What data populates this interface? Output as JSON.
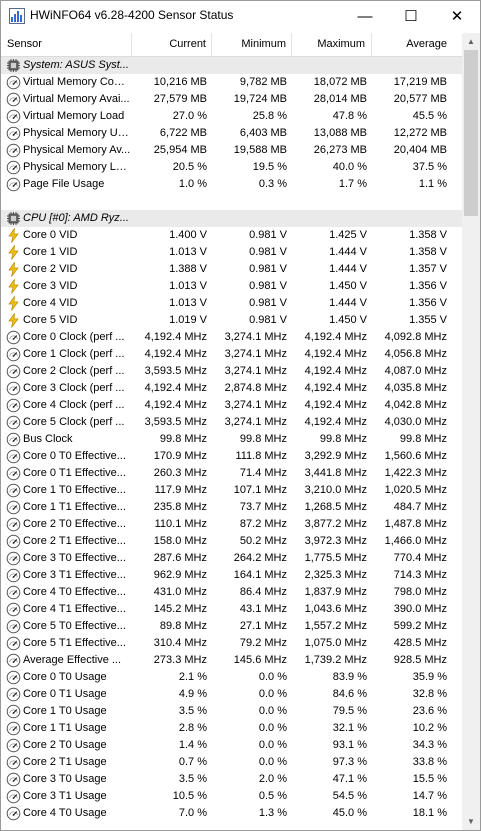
{
  "window": {
    "title": "HWiNFO64 v6.28-4200 Sensor Status",
    "minimize_glyph": "—",
    "maximize_glyph": "☐",
    "close_glyph": "✕"
  },
  "columns": {
    "sensor": "Sensor",
    "current": "Current",
    "minimum": "Minimum",
    "maximum": "Maximum",
    "average": "Average"
  },
  "rows": [
    {
      "kind": "group",
      "icon": "chip-icon",
      "name": "System: ASUS Syst..."
    },
    {
      "kind": "data",
      "icon": "gauge-icon",
      "name": "Virtual Memory Com...",
      "cur": "10,216 MB",
      "min": "9,782 MB",
      "max": "18,072 MB",
      "avg": "17,219 MB"
    },
    {
      "kind": "data",
      "icon": "gauge-icon",
      "name": "Virtual Memory Avai...",
      "cur": "27,579 MB",
      "min": "19,724 MB",
      "max": "28,014 MB",
      "avg": "20,577 MB"
    },
    {
      "kind": "data",
      "icon": "gauge-icon",
      "name": "Virtual Memory Load",
      "cur": "27.0 %",
      "min": "25.8 %",
      "max": "47.8 %",
      "avg": "45.5 %"
    },
    {
      "kind": "data",
      "icon": "gauge-icon",
      "name": "Physical Memory Used",
      "cur": "6,722 MB",
      "min": "6,403 MB",
      "max": "13,088 MB",
      "avg": "12,272 MB"
    },
    {
      "kind": "data",
      "icon": "gauge-icon",
      "name": "Physical Memory Av...",
      "cur": "25,954 MB",
      "min": "19,588 MB",
      "max": "26,273 MB",
      "avg": "20,404 MB"
    },
    {
      "kind": "data",
      "icon": "gauge-icon",
      "name": "Physical Memory Load",
      "cur": "20.5 %",
      "min": "19.5 %",
      "max": "40.0 %",
      "avg": "37.5 %"
    },
    {
      "kind": "data",
      "icon": "gauge-icon",
      "name": "Page File Usage",
      "cur": "1.0 %",
      "min": "0.3 %",
      "max": "1.7 %",
      "avg": "1.1 %"
    },
    {
      "kind": "blank"
    },
    {
      "kind": "group",
      "icon": "cpu-icon",
      "name": "CPU [#0]: AMD Ryz..."
    },
    {
      "kind": "data",
      "icon": "lightning-icon",
      "name": "Core 0 VID",
      "cur": "1.400 V",
      "min": "0.981 V",
      "max": "1.425 V",
      "avg": "1.358 V"
    },
    {
      "kind": "data",
      "icon": "lightning-icon",
      "name": "Core 1 VID",
      "cur": "1.013 V",
      "min": "0.981 V",
      "max": "1.444 V",
      "avg": "1.358 V"
    },
    {
      "kind": "data",
      "icon": "lightning-icon",
      "name": "Core 2 VID",
      "cur": "1.388 V",
      "min": "0.981 V",
      "max": "1.444 V",
      "avg": "1.357 V"
    },
    {
      "kind": "data",
      "icon": "lightning-icon",
      "name": "Core 3 VID",
      "cur": "1.013 V",
      "min": "0.981 V",
      "max": "1.450 V",
      "avg": "1.356 V"
    },
    {
      "kind": "data",
      "icon": "lightning-icon",
      "name": "Core 4 VID",
      "cur": "1.013 V",
      "min": "0.981 V",
      "max": "1.444 V",
      "avg": "1.356 V"
    },
    {
      "kind": "data",
      "icon": "lightning-icon",
      "name": "Core 5 VID",
      "cur": "1.019 V",
      "min": "0.981 V",
      "max": "1.450 V",
      "avg": "1.355 V"
    },
    {
      "kind": "data",
      "icon": "gauge-icon",
      "name": "Core 0 Clock (perf ...",
      "cur": "4,192.4 MHz",
      "min": "3,274.1 MHz",
      "max": "4,192.4 MHz",
      "avg": "4,092.8 MHz"
    },
    {
      "kind": "data",
      "icon": "gauge-icon",
      "name": "Core 1 Clock (perf ...",
      "cur": "4,192.4 MHz",
      "min": "3,274.1 MHz",
      "max": "4,192.4 MHz",
      "avg": "4,056.8 MHz"
    },
    {
      "kind": "data",
      "icon": "gauge-icon",
      "name": "Core 2 Clock (perf ...",
      "cur": "3,593.5 MHz",
      "min": "3,274.1 MHz",
      "max": "4,192.4 MHz",
      "avg": "4,087.0 MHz"
    },
    {
      "kind": "data",
      "icon": "gauge-icon",
      "name": "Core 3 Clock (perf ...",
      "cur": "4,192.4 MHz",
      "min": "2,874.8 MHz",
      "max": "4,192.4 MHz",
      "avg": "4,035.8 MHz"
    },
    {
      "kind": "data",
      "icon": "gauge-icon",
      "name": "Core 4 Clock (perf ...",
      "cur": "4,192.4 MHz",
      "min": "3,274.1 MHz",
      "max": "4,192.4 MHz",
      "avg": "4,042.8 MHz"
    },
    {
      "kind": "data",
      "icon": "gauge-icon",
      "name": "Core 5 Clock (perf ...",
      "cur": "3,593.5 MHz",
      "min": "3,274.1 MHz",
      "max": "4,192.4 MHz",
      "avg": "4,030.0 MHz"
    },
    {
      "kind": "data",
      "icon": "gauge-icon",
      "name": "Bus Clock",
      "cur": "99.8 MHz",
      "min": "99.8 MHz",
      "max": "99.8 MHz",
      "avg": "99.8 MHz"
    },
    {
      "kind": "data",
      "icon": "gauge-icon",
      "name": "Core 0 T0 Effective...",
      "cur": "170.9 MHz",
      "min": "111.8 MHz",
      "max": "3,292.9 MHz",
      "avg": "1,560.6 MHz"
    },
    {
      "kind": "data",
      "icon": "gauge-icon",
      "name": "Core 0 T1 Effective...",
      "cur": "260.3 MHz",
      "min": "71.4 MHz",
      "max": "3,441.8 MHz",
      "avg": "1,422.3 MHz"
    },
    {
      "kind": "data",
      "icon": "gauge-icon",
      "name": "Core 1 T0 Effective...",
      "cur": "117.9 MHz",
      "min": "107.1 MHz",
      "max": "3,210.0 MHz",
      "avg": "1,020.5 MHz"
    },
    {
      "kind": "data",
      "icon": "gauge-icon",
      "name": "Core 1 T1 Effective...",
      "cur": "235.8 MHz",
      "min": "73.7 MHz",
      "max": "1,268.5 MHz",
      "avg": "484.7 MHz"
    },
    {
      "kind": "data",
      "icon": "gauge-icon",
      "name": "Core 2 T0 Effective...",
      "cur": "110.1 MHz",
      "min": "87.2 MHz",
      "max": "3,877.2 MHz",
      "avg": "1,487.8 MHz"
    },
    {
      "kind": "data",
      "icon": "gauge-icon",
      "name": "Core 2 T1 Effective...",
      "cur": "158.0 MHz",
      "min": "50.2 MHz",
      "max": "3,972.3 MHz",
      "avg": "1,466.0 MHz"
    },
    {
      "kind": "data",
      "icon": "gauge-icon",
      "name": "Core 3 T0 Effective...",
      "cur": "287.6 MHz",
      "min": "264.2 MHz",
      "max": "1,775.5 MHz",
      "avg": "770.4 MHz"
    },
    {
      "kind": "data",
      "icon": "gauge-icon",
      "name": "Core 3 T1 Effective...",
      "cur": "962.9 MHz",
      "min": "164.1 MHz",
      "max": "2,325.3 MHz",
      "avg": "714.3 MHz"
    },
    {
      "kind": "data",
      "icon": "gauge-icon",
      "name": "Core 4 T0 Effective...",
      "cur": "431.0 MHz",
      "min": "86.4 MHz",
      "max": "1,837.9 MHz",
      "avg": "798.0 MHz"
    },
    {
      "kind": "data",
      "icon": "gauge-icon",
      "name": "Core 4 T1 Effective...",
      "cur": "145.2 MHz",
      "min": "43.1 MHz",
      "max": "1,043.6 MHz",
      "avg": "390.0 MHz"
    },
    {
      "kind": "data",
      "icon": "gauge-icon",
      "name": "Core 5 T0 Effective...",
      "cur": "89.8 MHz",
      "min": "27.1 MHz",
      "max": "1,557.2 MHz",
      "avg": "599.2 MHz"
    },
    {
      "kind": "data",
      "icon": "gauge-icon",
      "name": "Core 5 T1 Effective...",
      "cur": "310.4 MHz",
      "min": "79.2 MHz",
      "max": "1,075.0 MHz",
      "avg": "428.5 MHz"
    },
    {
      "kind": "data",
      "icon": "gauge-icon",
      "name": "Average Effective ...",
      "cur": "273.3 MHz",
      "min": "145.6 MHz",
      "max": "1,739.2 MHz",
      "avg": "928.5 MHz"
    },
    {
      "kind": "data",
      "icon": "gauge-icon",
      "name": "Core 0 T0 Usage",
      "cur": "2.1 %",
      "min": "0.0 %",
      "max": "83.9 %",
      "avg": "35.9 %"
    },
    {
      "kind": "data",
      "icon": "gauge-icon",
      "name": "Core 0 T1 Usage",
      "cur": "4.9 %",
      "min": "0.0 %",
      "max": "84.6 %",
      "avg": "32.8 %"
    },
    {
      "kind": "data",
      "icon": "gauge-icon",
      "name": "Core 1 T0 Usage",
      "cur": "3.5 %",
      "min": "0.0 %",
      "max": "79.5 %",
      "avg": "23.6 %"
    },
    {
      "kind": "data",
      "icon": "gauge-icon",
      "name": "Core 1 T1 Usage",
      "cur": "2.8 %",
      "min": "0.0 %",
      "max": "32.1 %",
      "avg": "10.2 %"
    },
    {
      "kind": "data",
      "icon": "gauge-icon",
      "name": "Core 2 T0 Usage",
      "cur": "1.4 %",
      "min": "0.0 %",
      "max": "93.1 %",
      "avg": "34.3 %"
    },
    {
      "kind": "data",
      "icon": "gauge-icon",
      "name": "Core 2 T1 Usage",
      "cur": "0.7 %",
      "min": "0.0 %",
      "max": "97.3 %",
      "avg": "33.8 %"
    },
    {
      "kind": "data",
      "icon": "gauge-icon",
      "name": "Core 3 T0 Usage",
      "cur": "3.5 %",
      "min": "2.0 %",
      "max": "47.1 %",
      "avg": "15.5 %"
    },
    {
      "kind": "data",
      "icon": "gauge-icon",
      "name": "Core 3 T1 Usage",
      "cur": "10.5 %",
      "min": "0.5 %",
      "max": "54.5 %",
      "avg": "14.7 %"
    },
    {
      "kind": "data",
      "icon": "gauge-icon",
      "name": "Core 4 T0 Usage",
      "cur": "7.0 %",
      "min": "1.3 %",
      "max": "45.0 %",
      "avg": "18.1 %"
    }
  ],
  "scrollbar": {
    "up_glyph": "▲",
    "down_glyph": "▼"
  }
}
